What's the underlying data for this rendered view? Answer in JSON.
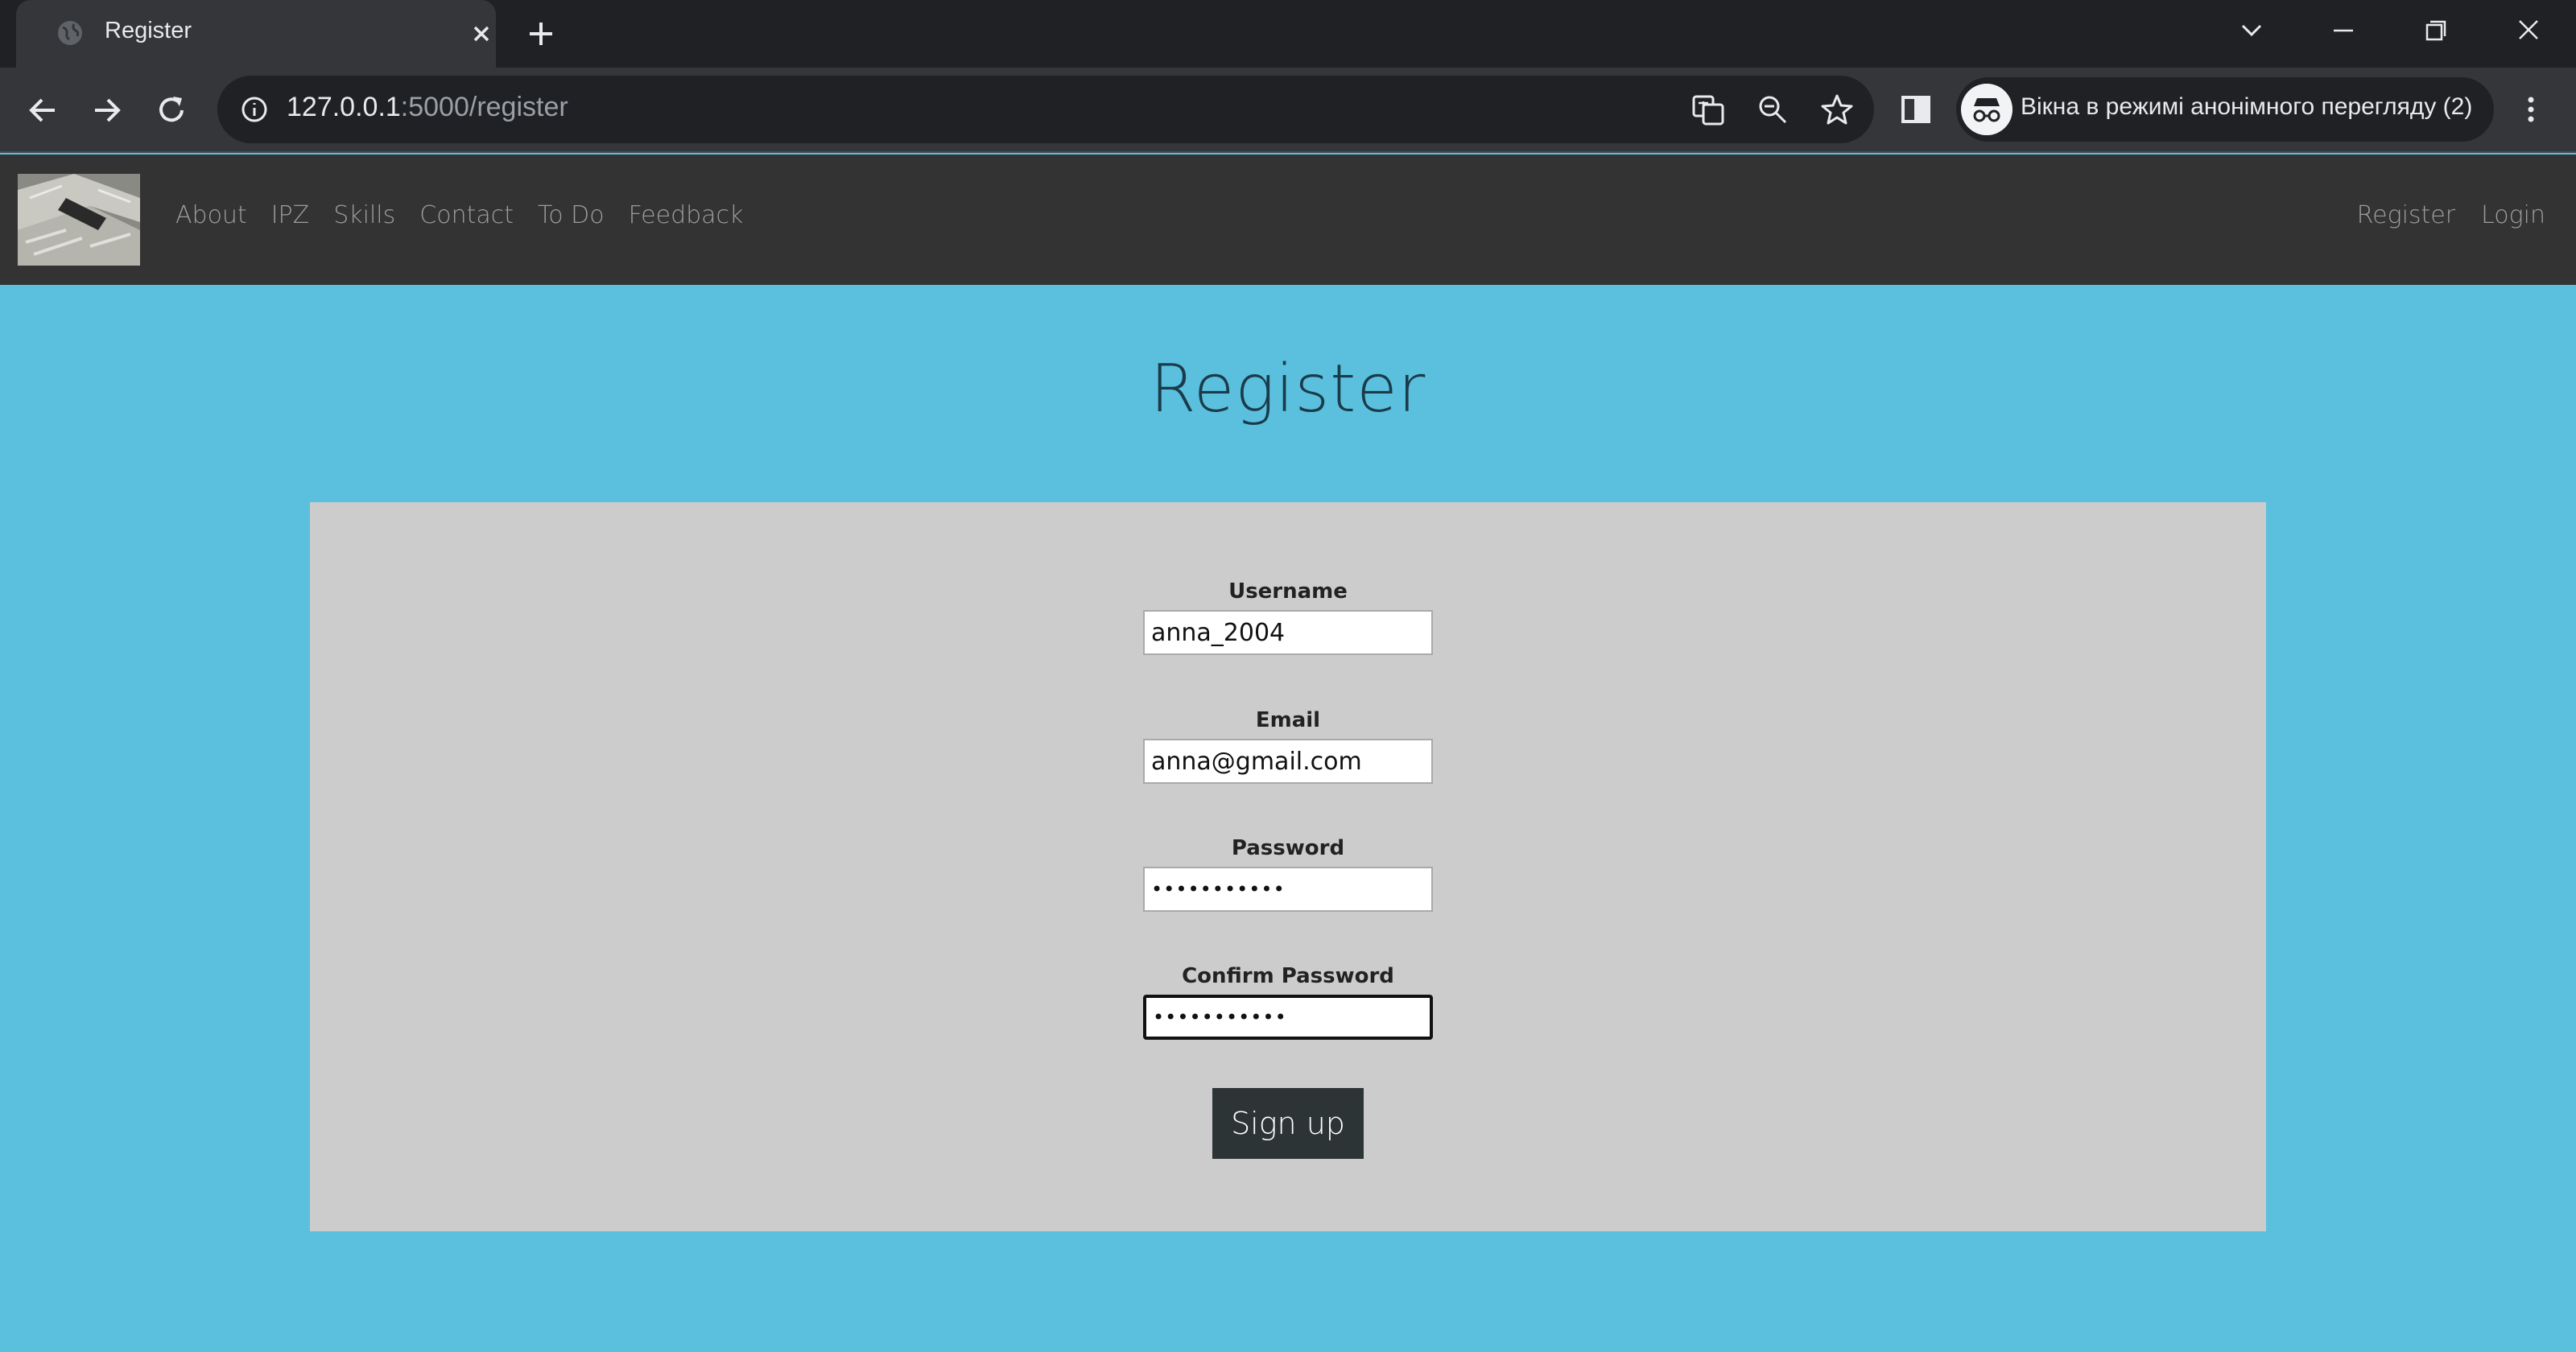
{
  "browser": {
    "tab_title": "Register",
    "url_host": "127.0.0.1",
    "url_path": ":5000/register",
    "incognito_label": "Вікна в режимі анонімного перегляду (2)"
  },
  "nav": {
    "links": [
      "About",
      "IPZ",
      "Skills",
      "Contact",
      "To Do",
      "Feedback"
    ],
    "right": [
      "Register",
      "Login"
    ]
  },
  "page": {
    "title": "Register",
    "fields": {
      "username": {
        "label": "Username",
        "value": "anna_2004"
      },
      "email": {
        "label": "Email",
        "value": "anna@gmail.com"
      },
      "password": {
        "label": "Password",
        "value": "•••••••••••"
      },
      "confirm": {
        "label": "Confirm Password",
        "value": "•••••••••••"
      }
    },
    "submit_label": "Sign up"
  },
  "colors": {
    "page_bg": "#5bc0de",
    "navbar_bg": "#333333",
    "panel_bg": "#cccccc",
    "button_bg": "#2d3436"
  }
}
